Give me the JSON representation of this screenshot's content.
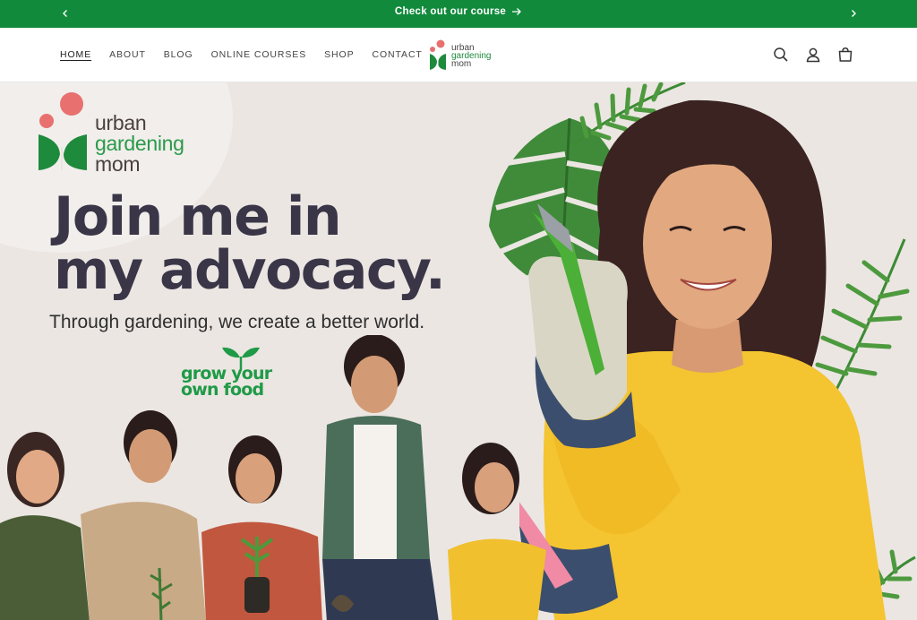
{
  "announcement": {
    "text": "Check out our course",
    "prev_icon": "chevron-left-icon",
    "next_icon": "chevron-right-icon",
    "background": "#118a3c"
  },
  "nav": {
    "items": [
      {
        "label": "HOME",
        "active": true
      },
      {
        "label": "ABOUT",
        "active": false
      },
      {
        "label": "BLOG",
        "active": false
      },
      {
        "label": "ONLINE COURSES",
        "active": false
      },
      {
        "label": "SHOP",
        "active": false
      },
      {
        "label": "CONTACT",
        "active": false
      }
    ]
  },
  "header_logo": {
    "line1": "urban",
    "line2": "gardening",
    "line3": "mom"
  },
  "header_icons": [
    "search-icon",
    "account-icon",
    "cart-icon"
  ],
  "hero": {
    "brand": {
      "line1": "urban",
      "line2": "gardening",
      "line3": "mom"
    },
    "headline_line1": "Join me in",
    "headline_line2": "my advocacy.",
    "subheadline": "Through gardening, we create a better world.",
    "badge_line1": "grow your",
    "badge_line2": "own food"
  },
  "colors": {
    "brand_green": "#1e8a3c",
    "headline": "#3a3648",
    "logo_pink": "#e8706e",
    "hero_bg": "#ebe6e2"
  }
}
